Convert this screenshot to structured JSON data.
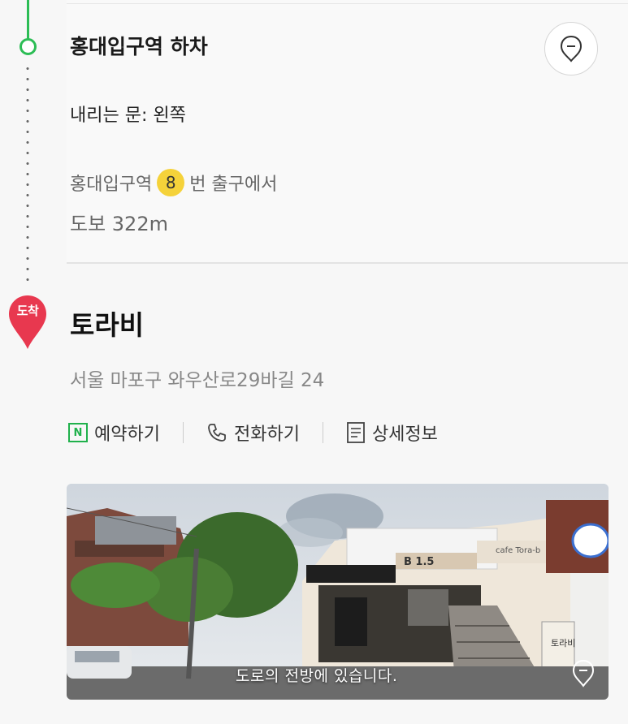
{
  "route": {
    "station_title": "홍대입구역 하차",
    "door_text": "내리는 문: 왼쪽",
    "exit_prefix": "홍대입구역",
    "exit_number": "8",
    "exit_suffix": "번 출구에서",
    "walk_text": "도보 322m"
  },
  "destination": {
    "badge": "도착",
    "name": "토라비",
    "address": "서울 마포구 와우산로29바길 24",
    "actions": [
      {
        "label": "예약하기",
        "icon": "naver-booking-icon"
      },
      {
        "label": "전화하기",
        "icon": "phone-icon"
      },
      {
        "label": "상세정보",
        "icon": "document-icon"
      }
    ],
    "photo_caption": "도로의 전방에 있습니다.",
    "photo_signs": [
      "cafe Tora-b",
      "B 1.5",
      "토라비"
    ]
  },
  "colors": {
    "accent_green": "#2cbd55",
    "arrival_red": "#e8384f",
    "exit_yellow": "#f5d23a"
  }
}
